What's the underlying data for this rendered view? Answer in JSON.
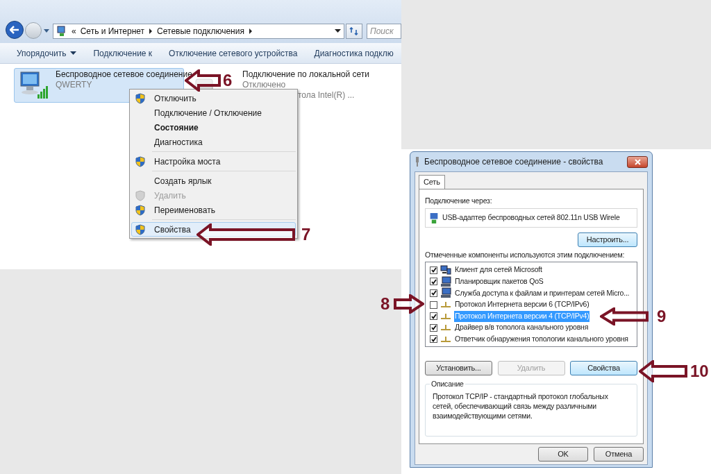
{
  "explorer": {
    "breadcrumb": [
      "«",
      "Сеть и Интернет",
      "Сетевые подключения"
    ],
    "search": {
      "placeholder": "Поиск"
    },
    "toolbar": [
      {
        "label": "Упорядочить",
        "dropdown": true
      },
      {
        "label": "Подключение к",
        "dropdown": false
      },
      {
        "label": "Отключение сетевого устройства",
        "dropdown": false
      },
      {
        "label": "Диагностика подклю",
        "dropdown": false
      }
    ],
    "connections": [
      {
        "name": "Беспроводное сетевое соединение",
        "status": "QWERTY",
        "selected": true,
        "kind": "wireless"
      },
      {
        "name": "Подключение по локальной сети",
        "status": "Отключено",
        "device": "тола Intel(R) ...",
        "selected": false,
        "kind": "wired"
      }
    ]
  },
  "context_menu": [
    {
      "label": "Отключить",
      "shield": true,
      "bold": false,
      "disabled": false,
      "selected": false
    },
    {
      "label": "Подключение / Отключение",
      "shield": false,
      "bold": false,
      "disabled": false,
      "selected": false
    },
    {
      "label": "Состояние",
      "shield": false,
      "bold": true,
      "disabled": false,
      "selected": false
    },
    {
      "label": "Диагностика",
      "shield": false,
      "bold": false,
      "disabled": false,
      "selected": false,
      "separator_after": true
    },
    {
      "label": "Настройка моста",
      "shield": true,
      "bold": false,
      "disabled": false,
      "selected": false,
      "separator_after": true
    },
    {
      "label": "Создать ярлык",
      "shield": false,
      "bold": false,
      "disabled": false,
      "selected": false
    },
    {
      "label": "Удалить",
      "shield": true,
      "bold": false,
      "disabled": true,
      "selected": false
    },
    {
      "label": "Переименовать",
      "shield": true,
      "bold": false,
      "disabled": false,
      "selected": false,
      "separator_after": true
    },
    {
      "label": "Свойства",
      "shield": true,
      "bold": false,
      "disabled": false,
      "selected": true
    }
  ],
  "dialog": {
    "title": "Беспроводное сетевое соединение - свойства",
    "tabs": [
      {
        "label": "Сеть",
        "selected": true
      }
    ],
    "connect_via_label": "Подключение через:",
    "adapter": "USB-адаптер беспроводных сетей 802.11n USB Wirele",
    "configure_button": "Настроить...",
    "components_label": "Отмеченные компоненты используются этим подключением:",
    "components": [
      {
        "label": "Клиент для сетей Microsoft",
        "kind": "client",
        "checked": true,
        "selected": false
      },
      {
        "label": "Планировщик пакетов QoS",
        "kind": "computer",
        "checked": true,
        "selected": false
      },
      {
        "label": "Служба доступа к файлам и принтерам сетей Micro...",
        "kind": "computer",
        "checked": true,
        "selected": false
      },
      {
        "label": "Протокол Интернета версии 6 (TCP/IPv6)",
        "kind": "protocol",
        "checked": false,
        "selected": false
      },
      {
        "label": "Протокол Интернета версии 4 (TCP/IPv4)",
        "kind": "protocol",
        "checked": true,
        "selected": true
      },
      {
        "label": "Драйвер в/в тополога канального уровня",
        "kind": "protocol",
        "checked": true,
        "selected": false
      },
      {
        "label": "Ответчик обнаружения топологии канального уровня",
        "kind": "protocol",
        "checked": true,
        "selected": false
      }
    ],
    "buttons": [
      {
        "label": "Установить...",
        "disabled": false,
        "focused": false
      },
      {
        "label": "Удалить",
        "disabled": true,
        "focused": false
      },
      {
        "label": "Свойства",
        "disabled": false,
        "focused": true
      }
    ],
    "description_title": "Описание",
    "description": "Протокол TCP/IP - стандартный протокол глобальных сетей, обеспечивающий связь между различными взаимодействующими сетями.",
    "footer_buttons": [
      "OK",
      "Отмена"
    ]
  },
  "annotations": [
    "6",
    "7",
    "8",
    "9",
    "10"
  ]
}
